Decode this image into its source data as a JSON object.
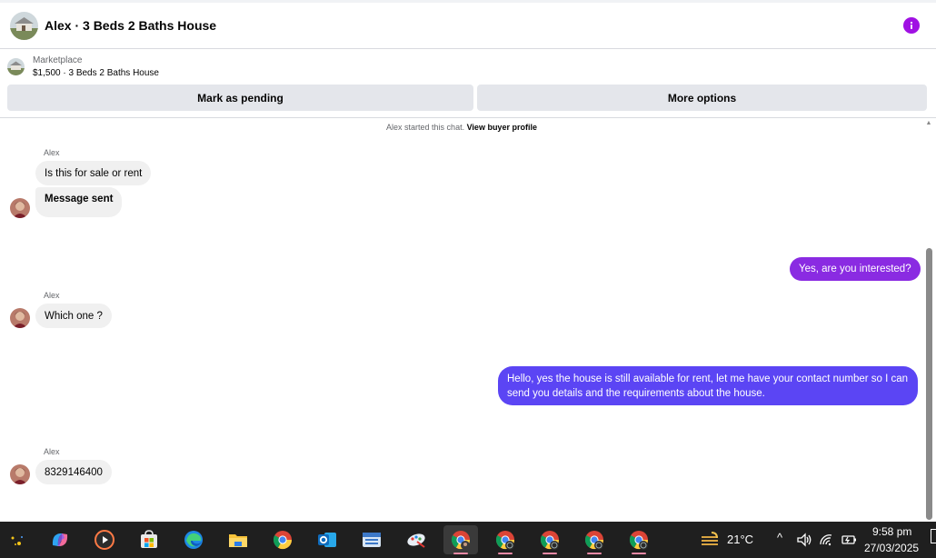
{
  "header": {
    "title": "Alex · 3 Beds 2 Baths House"
  },
  "listing": {
    "source_label": "Marketplace",
    "price_title": "$1,500 · 3 Beds 2 Baths House",
    "mark_pending_label": "Mark as pending",
    "more_options_label": "More options"
  },
  "chat": {
    "started_text": "Alex started this chat.",
    "view_profile_label": "View buyer profile",
    "messages": [
      {
        "sender": "Alex",
        "text": "Is this for sale or rent"
      },
      {
        "text": "Message sent"
      },
      {
        "text": "Yes, are you interested?"
      },
      {
        "sender": "Alex",
        "text": "Which one ?"
      },
      {
        "text": "Hello, yes the house is still available for rent, let me have your contact number so I can send you details and the requirements about the house."
      },
      {
        "sender": "Alex",
        "text": "8329146400"
      }
    ]
  },
  "taskbar": {
    "weather_temp": "21°C",
    "time": "9:58 pm",
    "date": "27/03/2025",
    "apps": [
      "copilot-icon",
      "media-player-icon",
      "store-icon",
      "edge-icon",
      "file-explorer-icon",
      "chrome-icon",
      "outlook-icon",
      "keyboard-app-icon",
      "paint-app-icon",
      "chrome-profile-icon",
      "chrome-profile-icon",
      "chrome-profile-icon",
      "chrome-profile-icon",
      "chrome-profile-icon"
    ]
  },
  "colors": {
    "outgoing_bubble_1": "#8a2be2",
    "outgoing_bubble_2": "#5b45f4",
    "incoming_bubble": "#f0f0f0",
    "accent": "#a011e3",
    "taskbar": "#1f1f1f"
  }
}
